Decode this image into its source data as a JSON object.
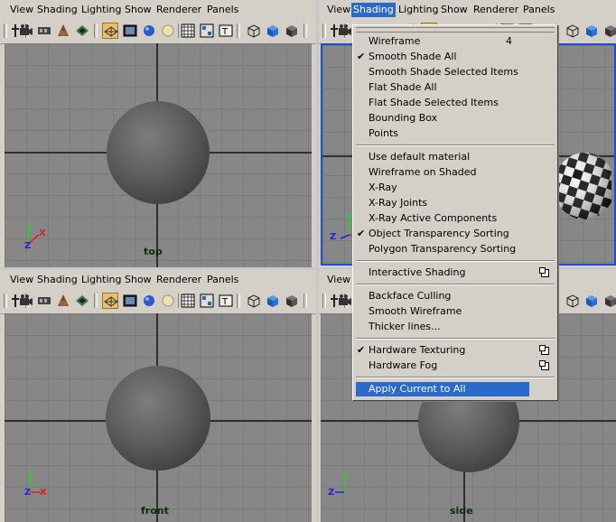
{
  "menubar_labels": [
    "View",
    "Shading",
    "Lighting",
    "Show",
    "Renderer",
    "Panels"
  ],
  "panels": {
    "top": {
      "camera": "top"
    },
    "persp": {
      "camera": ""
    },
    "front": {
      "camera": "front"
    },
    "side": {
      "camera": "side"
    }
  },
  "gizmo": {
    "x": "X",
    "y": "Y",
    "z": "Z"
  },
  "shading_menu": {
    "items": [
      {
        "label": "Wireframe",
        "accel": "4"
      },
      {
        "label": "Smooth Shade All",
        "checked": "✔"
      },
      {
        "label": "Smooth Shade Selected Items"
      },
      {
        "label": "Flat Shade All"
      },
      {
        "label": "Flat Shade Selected Items"
      },
      {
        "label": "Bounding Box"
      },
      {
        "label": "Points"
      },
      {
        "label": "Use default material"
      },
      {
        "label": "Wireframe on Shaded"
      },
      {
        "label": "X-Ray"
      },
      {
        "label": "X-Ray Joints"
      },
      {
        "label": "X-Ray Active Components"
      },
      {
        "label": "Object Transparency Sorting",
        "checked": "✔"
      },
      {
        "label": "Polygon Transparency Sorting"
      },
      {
        "label": "Interactive Shading"
      },
      {
        "label": "Backface Culling"
      },
      {
        "label": "Smooth Wireframe"
      },
      {
        "label": "Thicker lines..."
      },
      {
        "label": "Hardware Texturing",
        "checked": "✔"
      },
      {
        "label": "Hardware Fog"
      },
      {
        "label": "Apply Current to All"
      }
    ]
  },
  "colors": {
    "highlight": "#2a6acb",
    "active_panel_border": "#1a4fd0",
    "viewport_bg": "#878787",
    "camera_label": "#062f06"
  },
  "icons": [
    "snap-icon",
    "camera-icon",
    "film-icon",
    "bookmark-icon",
    "render-icon",
    "wireframe-icon",
    "shaded-icon",
    "texture-icon",
    "light-icon",
    "grid-icon",
    "xray-icon",
    "resolution-gate-icon",
    "wire-cube-icon",
    "blue-cube-icon",
    "gray-cube-icon"
  ]
}
